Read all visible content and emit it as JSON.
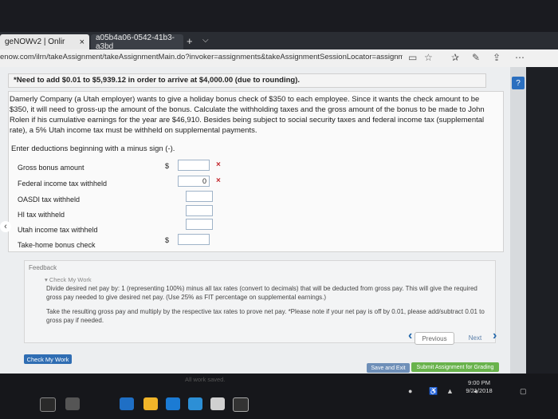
{
  "browser": {
    "tab_active_label": "geNOWv2 | Onlir",
    "tab_other_label": "a05b4a06-0542-41b3-a3bd",
    "tab_new": "+",
    "tab_dropdown": "⌵",
    "tab_close": "×",
    "url": "enow.com/ilrn/takeAssignment/takeAssignmentMain.do?invoker=assignments&takeAssignmentSessionLocator=assignment-take&inp"
  },
  "notice": "*Need to add $0.01 to $5,939.12 in order to arrive at $4,000.00 (due to rounding).",
  "problem_text": "Damerly Company (a Utah employer) wants to give a holiday bonus check of $350 to each employee. Since it wants the check amount to be $350, it will need to gross-up the amount of the bonus. Calculate the withholding taxes and the gross amount of the bonus to be made to John Rolen if his cumulative earnings for the year are $46,910. Besides being subject to social security taxes and federal income tax (supplemental rate), a 5% Utah income tax must be withheld on supplemental payments.",
  "instruction": "Enter deductions beginning with a minus sign (-).",
  "form": {
    "rows": [
      {
        "label": "Gross bonus amount",
        "dollar": "$",
        "value": "",
        "mark": "×"
      },
      {
        "label": "Federal income tax withheld",
        "dollar": "",
        "value": "0",
        "mark": "×"
      },
      {
        "label": "OASDI tax withheld",
        "dollar": "",
        "value": "",
        "mark": ""
      },
      {
        "label": "HI tax withheld",
        "dollar": "",
        "value": "",
        "mark": ""
      },
      {
        "label": "Utah income tax withheld",
        "dollar": "",
        "value": "",
        "mark": ""
      },
      {
        "label": "Take-home bonus check",
        "dollar": "$",
        "value": "",
        "mark": ""
      }
    ]
  },
  "feedback": {
    "title": "Feedback",
    "check_label": "▾ Check My Work",
    "text1": "Divide desired net pay by: 1 (representing 100%) minus all tax rates (convert to decimals) that will be deducted from gross pay. This will give the required gross pay needed to give desired net pay. (Use 25% as FIT percentage on supplemental earnings.)",
    "text2": "Take the resulting gross pay and multiply by the respective tax rates to prove net pay. *Please note if your net pay is off by 0.01, please add/subtract 0.01 to gross pay if needed."
  },
  "nav": {
    "previous": "Previous",
    "next": "Next"
  },
  "buttons": {
    "check_my_work": "Check My Work",
    "save_and_exit": "Save and Exit",
    "submit": "Submit Assignment for Grading"
  },
  "status": "All work saved.",
  "taskbar": {
    "time": "9:00 PM",
    "date": "9/21/2018"
  },
  "colors": {
    "accent": "#2f6db3",
    "submit": "#69b34c",
    "error": "#c4282d"
  }
}
